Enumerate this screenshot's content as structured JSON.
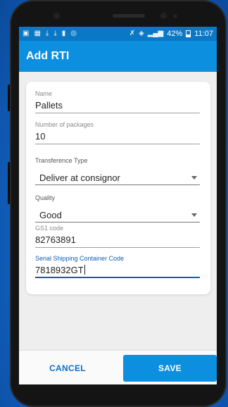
{
  "status_bar": {
    "left_icons": [
      "image-icon",
      "image-icon",
      "download-icon",
      "download-icon",
      "shield-icon",
      "vpn-icon"
    ],
    "battery": "42%",
    "time": "11:07"
  },
  "app_bar": {
    "title": "Add RTI"
  },
  "form": {
    "name": {
      "label": "Name",
      "value": "Pallets"
    },
    "packages": {
      "label": "Number of packages",
      "value": "10"
    },
    "transference": {
      "label": "Transference Type",
      "value": "Deliver at consignor"
    },
    "quality": {
      "label": "Quality",
      "value": "Good"
    },
    "gs1": {
      "label": "GS1 code",
      "value": "82763891"
    },
    "sscc": {
      "label": "Serial Shipping Container Code",
      "value": "7818932GT"
    }
  },
  "footer": {
    "cancel_label": "CANCEL",
    "save_label": "SAVE"
  },
  "colors": {
    "accent": "#0d8fe0",
    "status_bar": "#0b78c6",
    "focus": "#0b5fb8"
  }
}
